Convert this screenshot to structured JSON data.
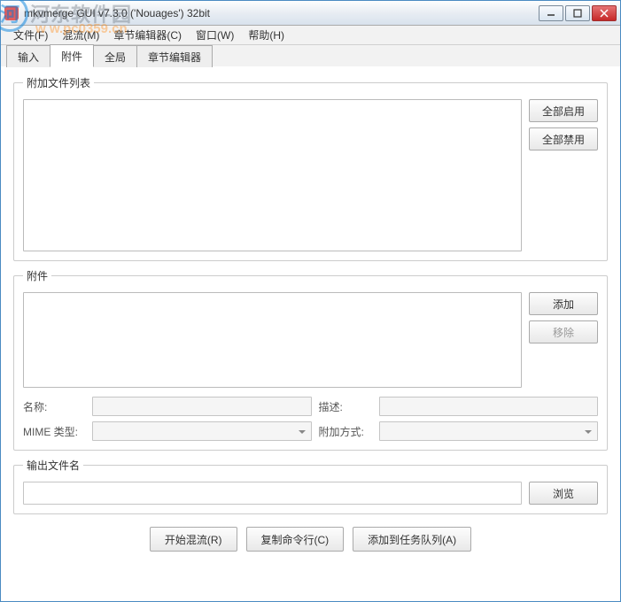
{
  "window": {
    "title": "mkvmerge GUI v7.3.0 ('Nouages') 32bit"
  },
  "watermark": {
    "logo": "河",
    "text": "河东软件园",
    "url": "w w.pc0359.cn"
  },
  "menu": {
    "file": "文件(F)",
    "mux": "混流(M)",
    "chapter_editor": "章节编辑器(C)",
    "window": "窗口(W)",
    "help": "帮助(H)"
  },
  "tabs": {
    "input": "输入",
    "attach": "附件",
    "global": "全局",
    "chapter": "章节编辑器"
  },
  "group_attachlist": {
    "legend": "附加文件列表",
    "enable_all": "全部启用",
    "disable_all": "全部禁用"
  },
  "group_attach": {
    "legend": "附件",
    "add": "添加",
    "remove": "移除",
    "name_label": "名称:",
    "desc_label": "描述:",
    "mime_label": "MIME 类型:",
    "method_label": "附加方式:"
  },
  "group_output": {
    "legend": "输出文件名",
    "browse": "浏览"
  },
  "buttons": {
    "start_mux": "开始混流(R)",
    "copy_cmd": "复制命令行(C)",
    "add_queue": "添加到任务队列(A)"
  }
}
